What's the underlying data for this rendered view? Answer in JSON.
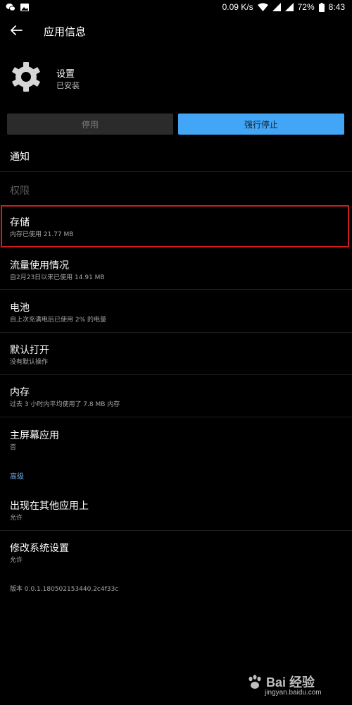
{
  "status_bar": {
    "speed": "0.09 K/s",
    "battery": "72%",
    "time": "8:43",
    "left_icons": [
      "wechat-icon",
      "image-icon"
    ],
    "right_icons": [
      "wifi-icon",
      "signal-icon",
      "signal-icon",
      "battery-icon"
    ]
  },
  "appbar": {
    "title": "应用信息"
  },
  "app": {
    "name": "设置",
    "status": "已安装"
  },
  "buttons": {
    "disable": "停用",
    "force_stop": "强行停止"
  },
  "rows": [
    {
      "title": "通知"
    },
    {
      "title": "权限"
    },
    {
      "title": "存储",
      "subtitle": "内存已使用 21.77 MB"
    },
    {
      "title": "流量使用情况",
      "subtitle": "自2月23日以来已使用 14.91 MB"
    },
    {
      "title": "电池",
      "subtitle": "自上次充满电后已使用 2% 的电量"
    },
    {
      "title": "默认打开",
      "subtitle": "没有默认操作"
    },
    {
      "title": "内存",
      "subtitle": "过去 3 小时内平均使用了 7.8 MB 内存"
    },
    {
      "title": "主屏幕应用",
      "subtitle": "否"
    }
  ],
  "advanced": {
    "header": "高级",
    "rows": [
      {
        "title": "出现在其他应用上",
        "subtitle": "允许"
      },
      {
        "title": "修改系统设置",
        "subtitle": "允许"
      }
    ]
  },
  "version": "版本 0.0.1.180502153440.2c4f33c",
  "watermark": {
    "brand": "Bai 经验",
    "url": "jingyan.baidu.com"
  },
  "colors": {
    "background": "#000000",
    "accent": "#42a5f5",
    "highlight": "#d01c1c",
    "section_header": "#6ea8e6"
  }
}
